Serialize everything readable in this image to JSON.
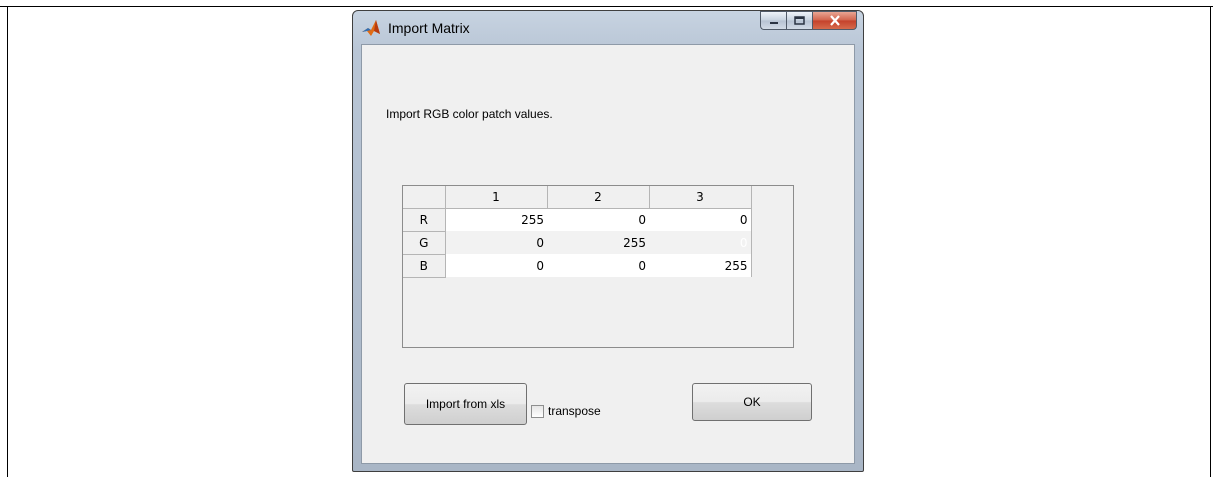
{
  "window": {
    "title": "Import Matrix",
    "minimize_icon": "minimize-icon",
    "maximize_icon": "maximize-icon",
    "close_icon": "close-icon"
  },
  "instruction": "Import RGB color patch values.",
  "table": {
    "column_headers": [
      "1",
      "2",
      "3"
    ],
    "rows": [
      {
        "label": "R",
        "values": [
          "255",
          "0",
          "0"
        ]
      },
      {
        "label": "G",
        "values": [
          "0",
          "255",
          "0"
        ]
      },
      {
        "label": "B",
        "values": [
          "0",
          "0",
          "255"
        ]
      }
    ],
    "selected_cell": {
      "row": 2,
      "col": 3
    }
  },
  "buttons": {
    "import_label": "Import from xls",
    "ok_label": "OK"
  },
  "transpose": {
    "label": "transpose",
    "checked": false
  },
  "colors": {
    "selection": "#3399ff",
    "close_button": "#c4412a"
  }
}
